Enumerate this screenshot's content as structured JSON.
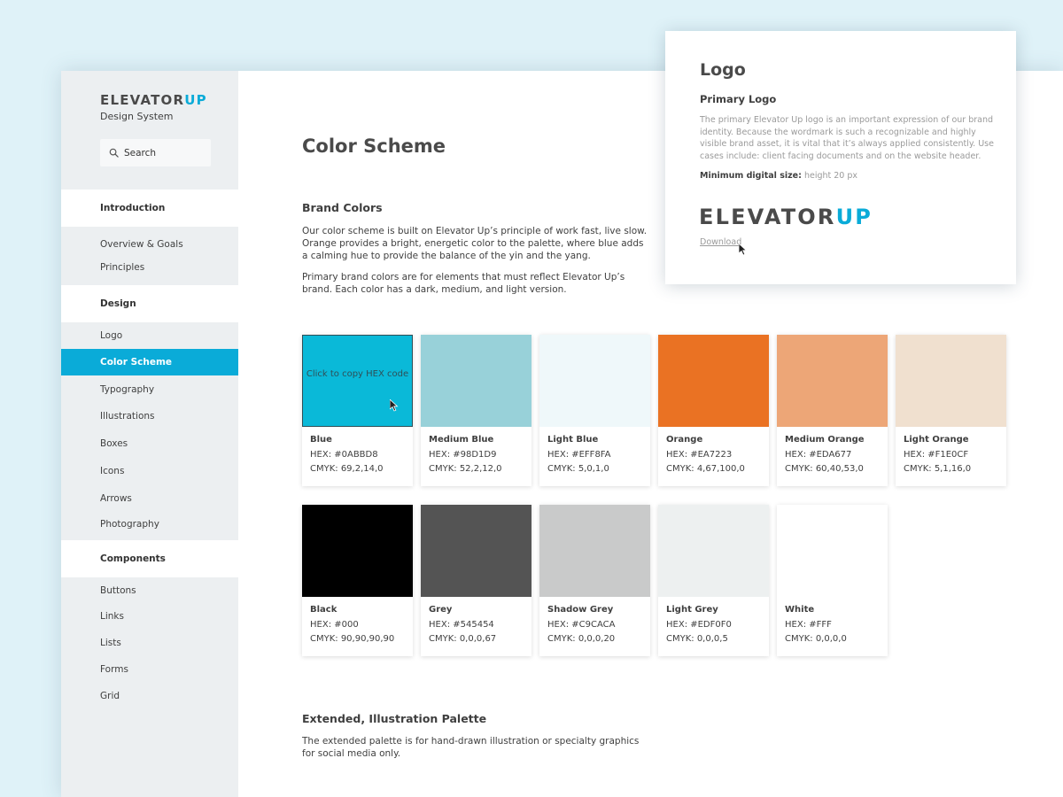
{
  "brand": {
    "logo_main": "ELEVATOR",
    "logo_accent": "UP",
    "subtitle": "Design System",
    "accent_color": "#0aabd8"
  },
  "search": {
    "placeholder": "Search",
    "icon": "search-icon"
  },
  "sidebar": {
    "sections": [
      {
        "label": "Introduction",
        "items": [
          "Overview & Goals",
          "Principles"
        ]
      },
      {
        "label": "Design",
        "items": [
          "Logo",
          "Color Scheme",
          "Typography",
          "Illustrations",
          "Boxes",
          "Icons",
          "Arrows",
          "Photography"
        ]
      },
      {
        "label": "Components",
        "items": [
          "Buttons",
          "Links",
          "Lists",
          "Forms",
          "Grid"
        ]
      }
    ],
    "active_item": "Color Scheme"
  },
  "main": {
    "title": "Color Scheme",
    "brand_colors": {
      "heading": "Brand Colors",
      "para1": "Our color scheme is built on Elevator Up’s principle of work fast, live slow. Orange provides a bright, energetic color to the palette, where blue adds a calming hue to provide the balance of the yin and the yang.",
      "para2": "Primary brand colors are for elements that must reflect Elevator Up’s brand. Each color has a dark, medium, and light version."
    },
    "copy_hint": "Click to copy HEX code",
    "swatches": [
      {
        "name": "Blue",
        "hex": "HEX: #0ABBD8",
        "cmyk": "CMYK: 69,2,14,0",
        "color": "#0ab9d8"
      },
      {
        "name": "Medium Blue",
        "hex": "HEX: #98D1D9",
        "cmyk": "CMYK: 52,2,12,0",
        "color": "#98d1d9"
      },
      {
        "name": "Light Blue",
        "hex": "HEX: #EFF8FA",
        "cmyk": "CMYK: 5,0,1,0",
        "color": "#eff8fa"
      },
      {
        "name": "Orange",
        "hex": "HEX: #EA7223",
        "cmyk": "CMYK: 4,67,100,0",
        "color": "#ea7223"
      },
      {
        "name": "Medium Orange",
        "hex": "HEX: #EDA677",
        "cmyk": "CMYK: 60,40,53,0",
        "color": "#eda677"
      },
      {
        "name": "Light Orange",
        "hex": "HEX: #F1E0CF",
        "cmyk": "CMYK: 5,1,16,0",
        "color": "#f0e0cf"
      },
      {
        "name": "Black",
        "hex": "HEX: #000",
        "cmyk": "CMYK: 90,90,90,90",
        "color": "#000000"
      },
      {
        "name": "Grey",
        "hex": "HEX: #545454",
        "cmyk": "CMYK: 0,0,0,67",
        "color": "#545454"
      },
      {
        "name": "Shadow Grey",
        "hex": "HEX: #C9CACA",
        "cmyk": "CMYK: 0,0,0,20",
        "color": "#c9caca"
      },
      {
        "name": "Light Grey",
        "hex": "HEX: #EDF0F0",
        "cmyk": "CMYK: 0,0,0,5",
        "color": "#edf0f0"
      },
      {
        "name": "White",
        "hex": "HEX: #FFF",
        "cmyk": "CMYK: 0,0,0,0",
        "color": "#ffffff"
      }
    ],
    "extended": {
      "heading": "Extended, Illustration Palette",
      "para": "The extended palette is for hand-drawn illustration or specialty graphics for social media only."
    }
  },
  "logo_panel": {
    "title": "Logo",
    "subtitle": "Primary Logo",
    "description": "The primary Elevator Up logo is an important expression of our brand identity. Because the wordmark is such a recognizable and highly visible brand asset, it is vital that it’s always applied consistently. Use cases include: client facing documents and on the website header.",
    "min_label": "Minimum digital size:",
    "min_value": "height 20 px",
    "logo_main": "ELEVATOR",
    "logo_accent": "UP",
    "download": "Download"
  }
}
